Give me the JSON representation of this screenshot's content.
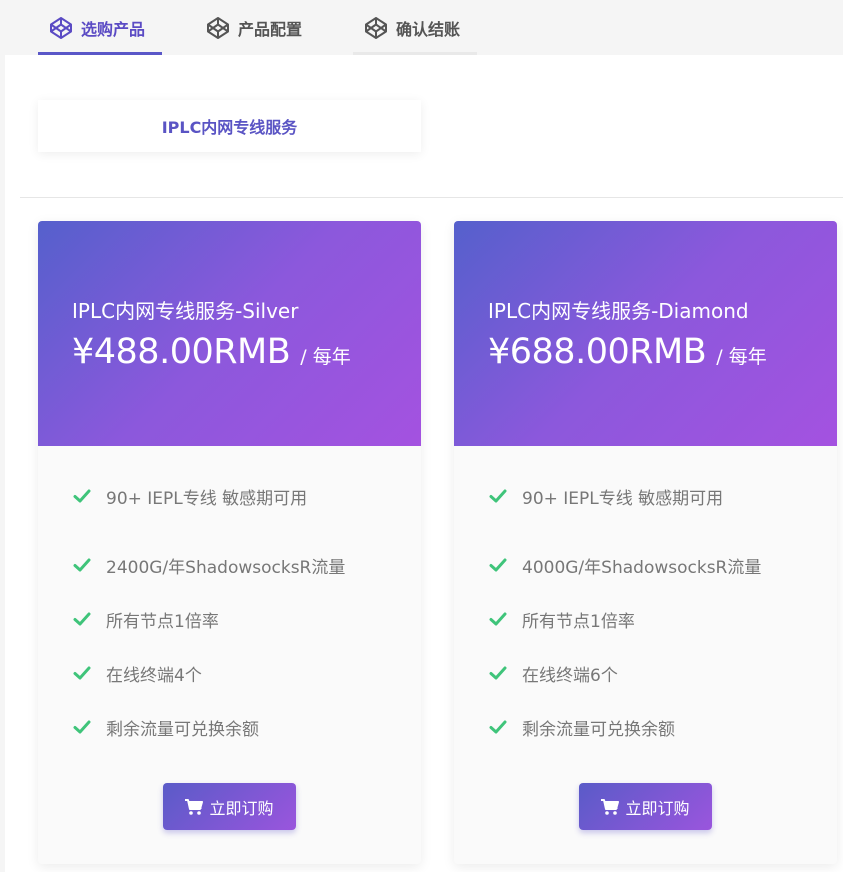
{
  "tabs": [
    {
      "label": "选购产品",
      "icon": "codepen-icon",
      "active": true
    },
    {
      "label": "产品配置",
      "icon": "codepen-icon",
      "active": false
    },
    {
      "label": "确认结账",
      "icon": "codepen-icon",
      "active": false
    }
  ],
  "category": {
    "label": "IPLC内网专线服务"
  },
  "cards": [
    {
      "name": "IPLC内网专线服务-Silver",
      "price": "¥488.00RMB",
      "period": "/ 每年",
      "features": [
        "90+ IEPL专线 敏感期可用",
        "2400G/年ShadowsocksR流量",
        "所有节点1倍率",
        "在线终端4个",
        "剩余流量可兑换余额"
      ],
      "button": "立即订购"
    },
    {
      "name": "IPLC内网专线服务-Diamond",
      "price": "¥688.00RMB",
      "period": "/ 每年",
      "features": [
        "90+ IEPL专线 敏感期可用",
        "4000G/年ShadowsocksR流量",
        "所有节点1倍率",
        "在线终端6个",
        "剩余流量可兑换余额"
      ],
      "button": "立即订购"
    }
  ],
  "colors": {
    "accent": "#5a57c8",
    "check": "#3fc47a",
    "gradient_start": "#5560cc",
    "gradient_end": "#a452e0"
  }
}
